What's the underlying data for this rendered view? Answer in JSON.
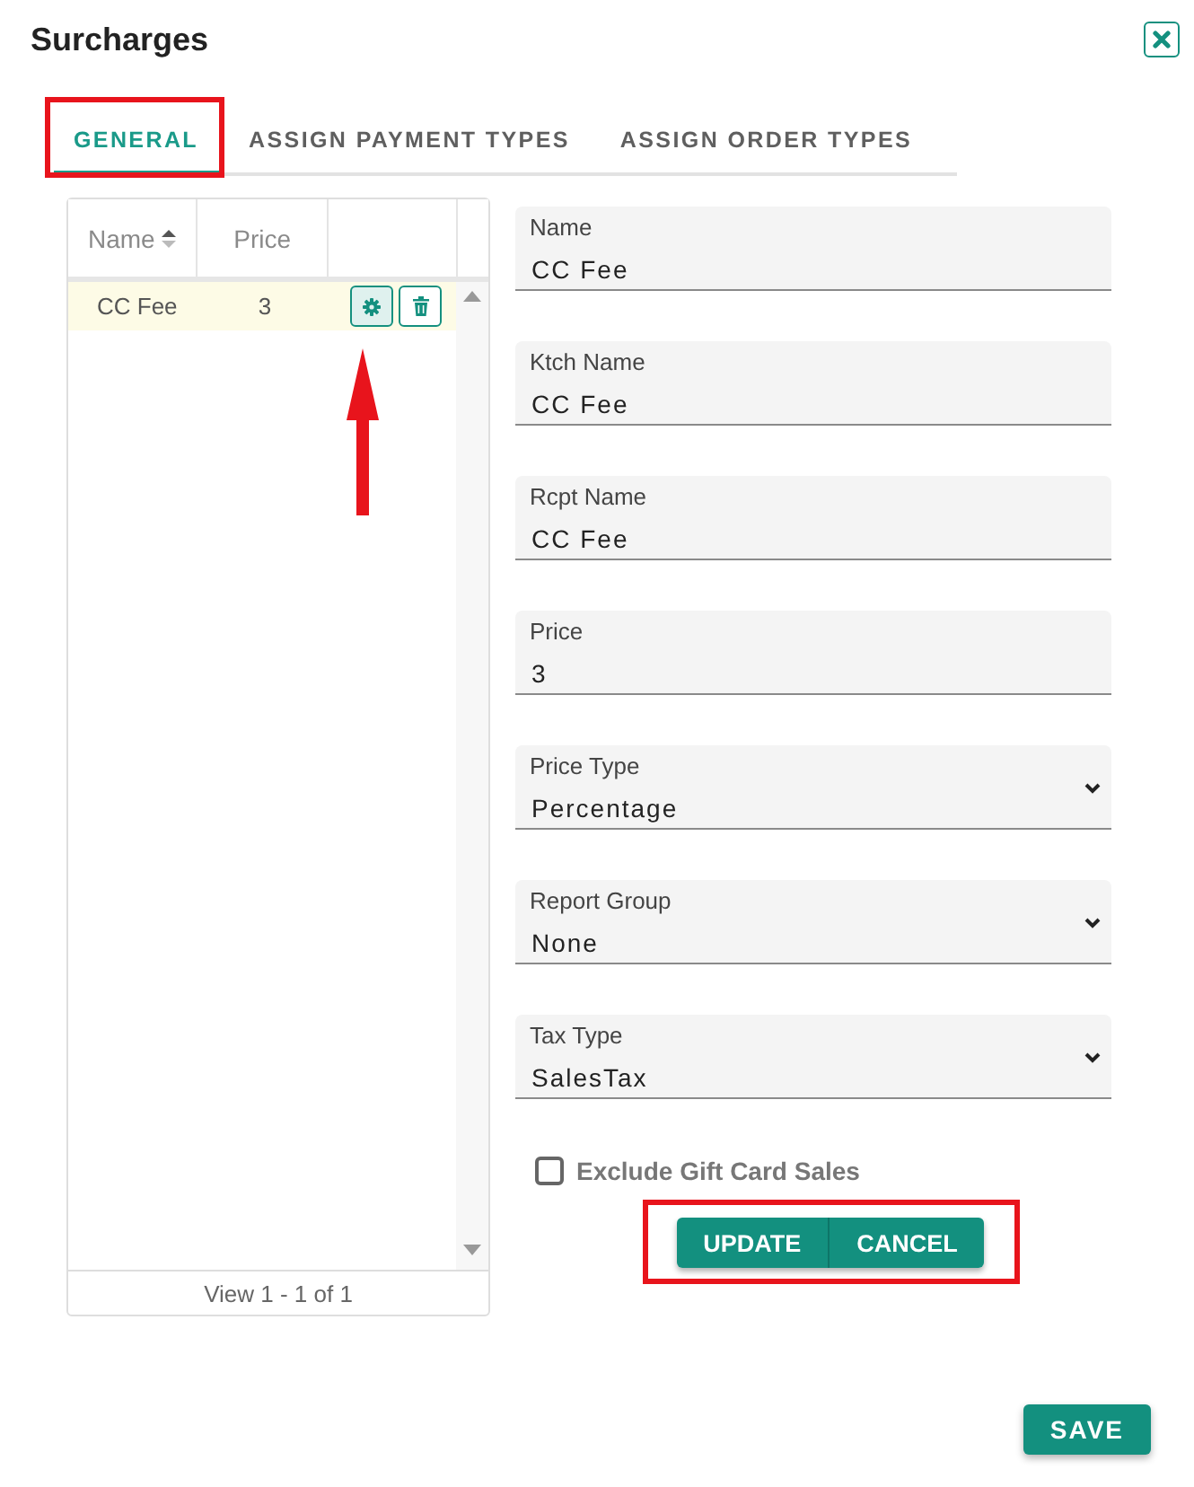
{
  "dialog": {
    "title": "Surcharges"
  },
  "tabs": [
    {
      "label": "GENERAL",
      "selected": true,
      "highlighted": true
    },
    {
      "label": "ASSIGN PAYMENT TYPES",
      "selected": false,
      "highlighted": false
    },
    {
      "label": "ASSIGN ORDER TYPES",
      "selected": false,
      "highlighted": false
    }
  ],
  "grid": {
    "columns": [
      {
        "label": "Name",
        "sortable": true
      },
      {
        "label": "Price",
        "sortable": false
      }
    ],
    "rows": [
      {
        "name": "CC Fee",
        "price": "3",
        "selected": true,
        "pointed_at": true
      }
    ],
    "footer": "View 1 - 1 of 1"
  },
  "form": {
    "fields": [
      {
        "kind": "text",
        "label": "Name",
        "value": "CC Fee"
      },
      {
        "kind": "text",
        "label": "Ktch Name",
        "value": "CC Fee"
      },
      {
        "kind": "text",
        "label": "Rcpt Name",
        "value": "CC Fee"
      },
      {
        "kind": "text",
        "label": "Price",
        "value": "3"
      },
      {
        "kind": "select",
        "label": "Price Type",
        "value": "Percentage"
      },
      {
        "kind": "select",
        "label": "Report Group",
        "value": "None"
      },
      {
        "kind": "select",
        "label": "Tax Type",
        "value": "SalesTax"
      }
    ],
    "checkbox": {
      "label": "Exclude Gift Card Sales",
      "checked": false
    },
    "buttons": [
      {
        "label": "UPDATE"
      },
      {
        "label": "CANCEL"
      }
    ],
    "buttons_highlighted": true
  },
  "footer_buttons": [
    {
      "label": "SAVE"
    }
  ]
}
